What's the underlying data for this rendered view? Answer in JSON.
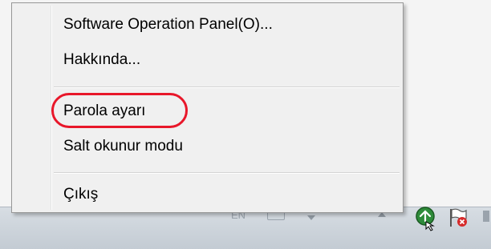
{
  "context_menu": {
    "items": [
      {
        "label": "Software Operation Panel(O)..."
      },
      {
        "label": "Hakkında..."
      },
      {
        "label": "Parola ayarı"
      },
      {
        "label": "Salt okunur modu"
      },
      {
        "label": "Çıkış"
      }
    ]
  },
  "taskbar": {
    "language_indicator": "EN"
  },
  "colors": {
    "highlight_ring": "#e8172a",
    "menu_background": "#f0f0f0"
  },
  "icons": [
    "keyboard-icon",
    "chevron-down-icon",
    "chevron-up-icon",
    "scanner-tray-icon",
    "action-center-flag-icon"
  ]
}
